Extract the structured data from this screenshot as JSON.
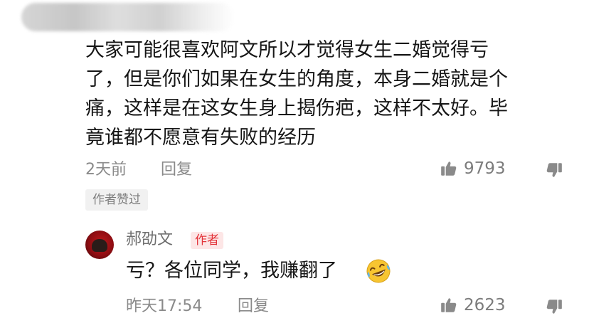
{
  "comment": {
    "text_lines": [
      "大家可能很喜欢阿文所以才觉得女生二婚觉得亏",
      "了，但是你们如果在女生的角度，本身二婚就是个",
      "痛，这样是在这女生身上揭伤疤，这样不太好。毕",
      "竟谁都不愿意有失败的经历"
    ],
    "time": "2天前",
    "reply_label": "回复",
    "likes": "9793",
    "author_liked_tag": "作者赞过"
  },
  "reply": {
    "username": "郝劭文",
    "author_badge": "作者",
    "text": "亏？各位同学，我赚翻了",
    "time": "昨天17:54",
    "reply_label": "回复",
    "likes": "2623"
  },
  "icons": {
    "like": "thumbs-up-icon",
    "dislike": "thumbs-down-icon",
    "emoji": "rolling-laughing-emoji-icon"
  }
}
